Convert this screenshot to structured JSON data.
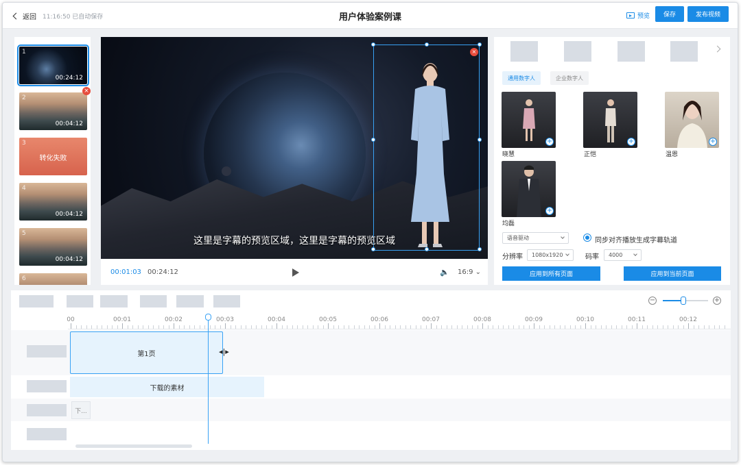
{
  "header": {
    "back_label": "返回",
    "saved_status": "11:16:50 已自动保存",
    "title": "用户体验案例课",
    "preview_label": "预览",
    "save_label": "保存",
    "publish_label": "发布视频"
  },
  "slides": [
    {
      "num": "1",
      "duration": "00:24:12",
      "selected": true
    },
    {
      "num": "2",
      "duration": "00:04:12"
    },
    {
      "num": "3",
      "status": "转化失败"
    },
    {
      "num": "4",
      "duration": "00:04:12"
    },
    {
      "num": "5",
      "duration": "00:04:12"
    },
    {
      "num": "6",
      "duration": ""
    }
  ],
  "canvas": {
    "subtitle": "这里是字幕的预览区域，这里是字幕的预览区域",
    "current_time": "00:01:03",
    "total_time": "00:24:12",
    "aspect_ratio": "16:9"
  },
  "right_panel": {
    "chips": [
      "通用数字人",
      "企业数字人"
    ],
    "avatars": [
      {
        "name": "晓慧",
        "icon": "female-avatar"
      },
      {
        "name": "正恺",
        "icon": "male-avatar"
      },
      {
        "name": "温恩",
        "icon": "female-avatar"
      },
      {
        "name": "均磊",
        "icon": "male-avatar"
      }
    ],
    "drive_mode": "语音驱动",
    "sync_label": "同步对齐播放生成字幕轨道",
    "resolution_label": "分辨率",
    "resolution_value": "1080x1920",
    "bitrate_label": "码率",
    "bitrate_value": "4000",
    "apply_all_label": "应用到所有页面",
    "apply_current_label": "应用到当前页面"
  },
  "timeline": {
    "ruler_labels": [
      "00",
      "00:01",
      "00:02",
      "00:03",
      "00:04",
      "00:05",
      "00:06",
      "00:07",
      "00:08",
      "00:09",
      "00:10",
      "00:11",
      "00:12"
    ],
    "page_clip_label": "第1页",
    "material_clip_label": "下载的素材",
    "small_clip_label": "下..."
  },
  "colors": {
    "accent": "#1a8be6",
    "error": "#e74c3c"
  }
}
